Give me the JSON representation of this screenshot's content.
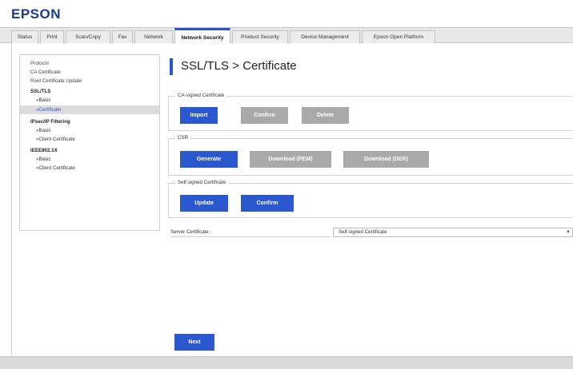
{
  "app": {
    "logo": "EPSON"
  },
  "tabs": [
    {
      "label": "Status"
    },
    {
      "label": "Print"
    },
    {
      "label": "Scan/Copy"
    },
    {
      "label": "Fax"
    },
    {
      "label": "Network"
    },
    {
      "label": "Network Security",
      "active": true
    },
    {
      "label": "Product Security"
    },
    {
      "label": "Device Management"
    },
    {
      "label": "Epson Open Platform"
    }
  ],
  "sidebar": {
    "items": [
      {
        "label": "Protocol"
      },
      {
        "label": "CA Certificate"
      },
      {
        "label": "Root Certificate Update"
      },
      {
        "label": "SSL/TLS"
      },
      {
        "label": "»Basic"
      },
      {
        "label": "»Certificate"
      },
      {
        "label": "IPsec/IP Filtering"
      },
      {
        "label": "»Basic"
      },
      {
        "label": "»Client Certificate"
      },
      {
        "label": "IEEE802.1X"
      },
      {
        "label": "»Basic"
      },
      {
        "label": "»Client Certificate"
      }
    ]
  },
  "page": {
    "title": "SSL/TLS > Certificate"
  },
  "ca_signed": {
    "legend": "CA-signed Certificate",
    "import_label": "Import",
    "confirm_label": "Confirm",
    "delete_label": "Delete"
  },
  "csr": {
    "legend": "CSR",
    "generate_label": "Generate",
    "download_pem_label": "Download (PEM)",
    "download_der_label": "Download (DER)"
  },
  "self_signed": {
    "legend": "Self-signed Certificate",
    "update_label": "Update",
    "confirm_label": "Confirm"
  },
  "server_certificate": {
    "label": "Server Certificate :",
    "value": "Self-signed Certificate"
  },
  "footer": {
    "next_label": "Next"
  },
  "colors": {
    "accent": "#2c58cf",
    "disabled": "#a9a9a9",
    "brand": "#1a3b8c"
  }
}
